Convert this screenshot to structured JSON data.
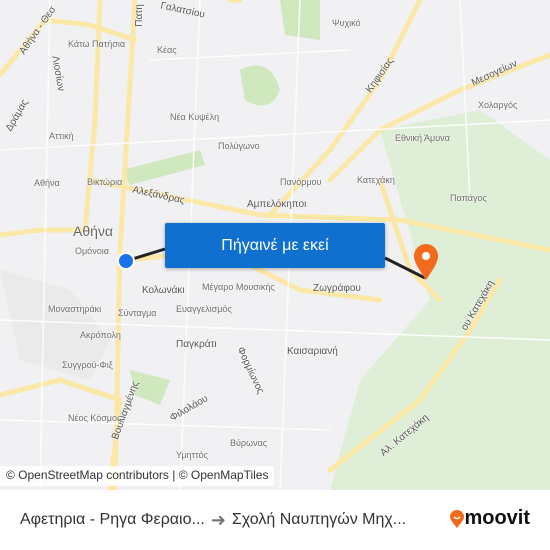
{
  "map": {
    "labels": {
      "galatsiou": "Γαλατσίου",
      "psychiko": "Ψυχικό",
      "kato_patisia": "Κάτω Πατήσια",
      "keas": "Κέας",
      "mesogeion": "Μεσογείων",
      "kifisias": "Κηφισίας",
      "cholargos": "Χολαργός",
      "nea_kypseli": "Νέα Κυψέλη",
      "polygono": "Πολύγωνο",
      "ethniki_amyna": "Εθνική Άμυνα",
      "attiki": "Αττική",
      "dramas": "Δράμας",
      "liosion": "Λιοσίων",
      "athina_thess": "Αθήνα - Θεσ",
      "athina_station": "Αθήνα",
      "viktoria": "Βικτώρια",
      "alexandras": "Αλεξάνδρας",
      "panormou": "Πανόρμου",
      "katechaki": "Κατεχάκη",
      "papagos": "Παπάγος",
      "ampelokipoi": "Αμπελόκηποι",
      "athina_city": "Αθήνα",
      "omonoia": "Ομόνοια",
      "kolonaki": "Κολωνάκι",
      "megaro": "Μέγαρο Μουσικής",
      "zografou": "Ζωγράφου",
      "syntagma": "Σύνταγμα",
      "monastiraki": "Μοναστηράκι",
      "evangelismos": "Ευαγγελισμός",
      "pagkrati": "Παγκράτι",
      "kaisariani": "Καισαριανή",
      "akropoli": "Ακρόπολη",
      "formionos": "Φορμίωνος",
      "syngrou": "Συγγρού-Φιξ",
      "filolaou": "Φιλολάου",
      "vouliagmenis": "Βουλιαγμένης",
      "vyronas": "Βύρωνας",
      "neos_kosmos": "Νέος Κόσμος",
      "ymittos": "Υμηττός",
      "patision": "Πατη",
      "al_katechaki": "Αλ. Κατεχάκη",
      "katechaki_road": "ου Κατεχάκη"
    },
    "go_button": "Πήγαινέ με εκεί",
    "attribution": "© OpenStreetMap contributors | © OpenMapTiles",
    "colors": {
      "route": "#222222",
      "origin": "#1a73e8",
      "destination": "#f26b1d",
      "button": "#1070d0"
    }
  },
  "footer": {
    "origin": "Αφετηρια - Ρηγα Φεραιο...",
    "destination": "Σχολή Ναυπηγών Μηχ...",
    "brand": "moovit"
  }
}
